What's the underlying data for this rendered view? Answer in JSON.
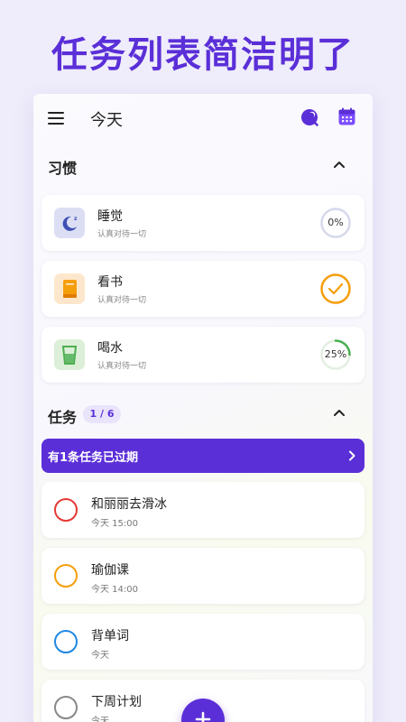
{
  "headline": "任务列表简洁明了",
  "appbar": {
    "title": "今天",
    "menu_icon": "menu-icon",
    "theme_icon": "theme-icon",
    "calendar_icon": "calendar-icon"
  },
  "habits": {
    "title": "习惯",
    "items": [
      {
        "name": "睡觉",
        "subtitle": "认真对待一切",
        "progress_label": "0%",
        "progress": 0,
        "icon": "sleep-moon-icon",
        "icon_bg": "#dcdff4",
        "ring_color": "#c9cce8"
      },
      {
        "name": "看书",
        "subtitle": "认真对待一切",
        "progress_label": "",
        "progress": 100,
        "icon": "book-icon",
        "icon_bg": "#fde7cc",
        "ring_color": "#f59e0b"
      },
      {
        "name": "喝水",
        "subtitle": "认真对待一切",
        "progress_label": "25%",
        "progress": 25,
        "icon": "water-glass-icon",
        "icon_bg": "#dcefd8",
        "ring_color": "#4caf50"
      }
    ]
  },
  "tasks": {
    "title": "任务",
    "badge": "1 / 6",
    "overdue_banner": "有1条任务已过期",
    "items": [
      {
        "title": "和丽丽去滑冰",
        "time": "今天 15:00",
        "color": "#e53935"
      },
      {
        "title": "瑜伽课",
        "time": "今天 14:00",
        "color": "#f59e0b"
      },
      {
        "title": "背单词",
        "time": "今天",
        "color": "#1e88e5"
      },
      {
        "title": "下周计划",
        "time": "今天",
        "color": "#888888"
      }
    ]
  },
  "colors": {
    "accent": "#5b2fd8"
  },
  "fab": {
    "icon": "plus-icon"
  }
}
